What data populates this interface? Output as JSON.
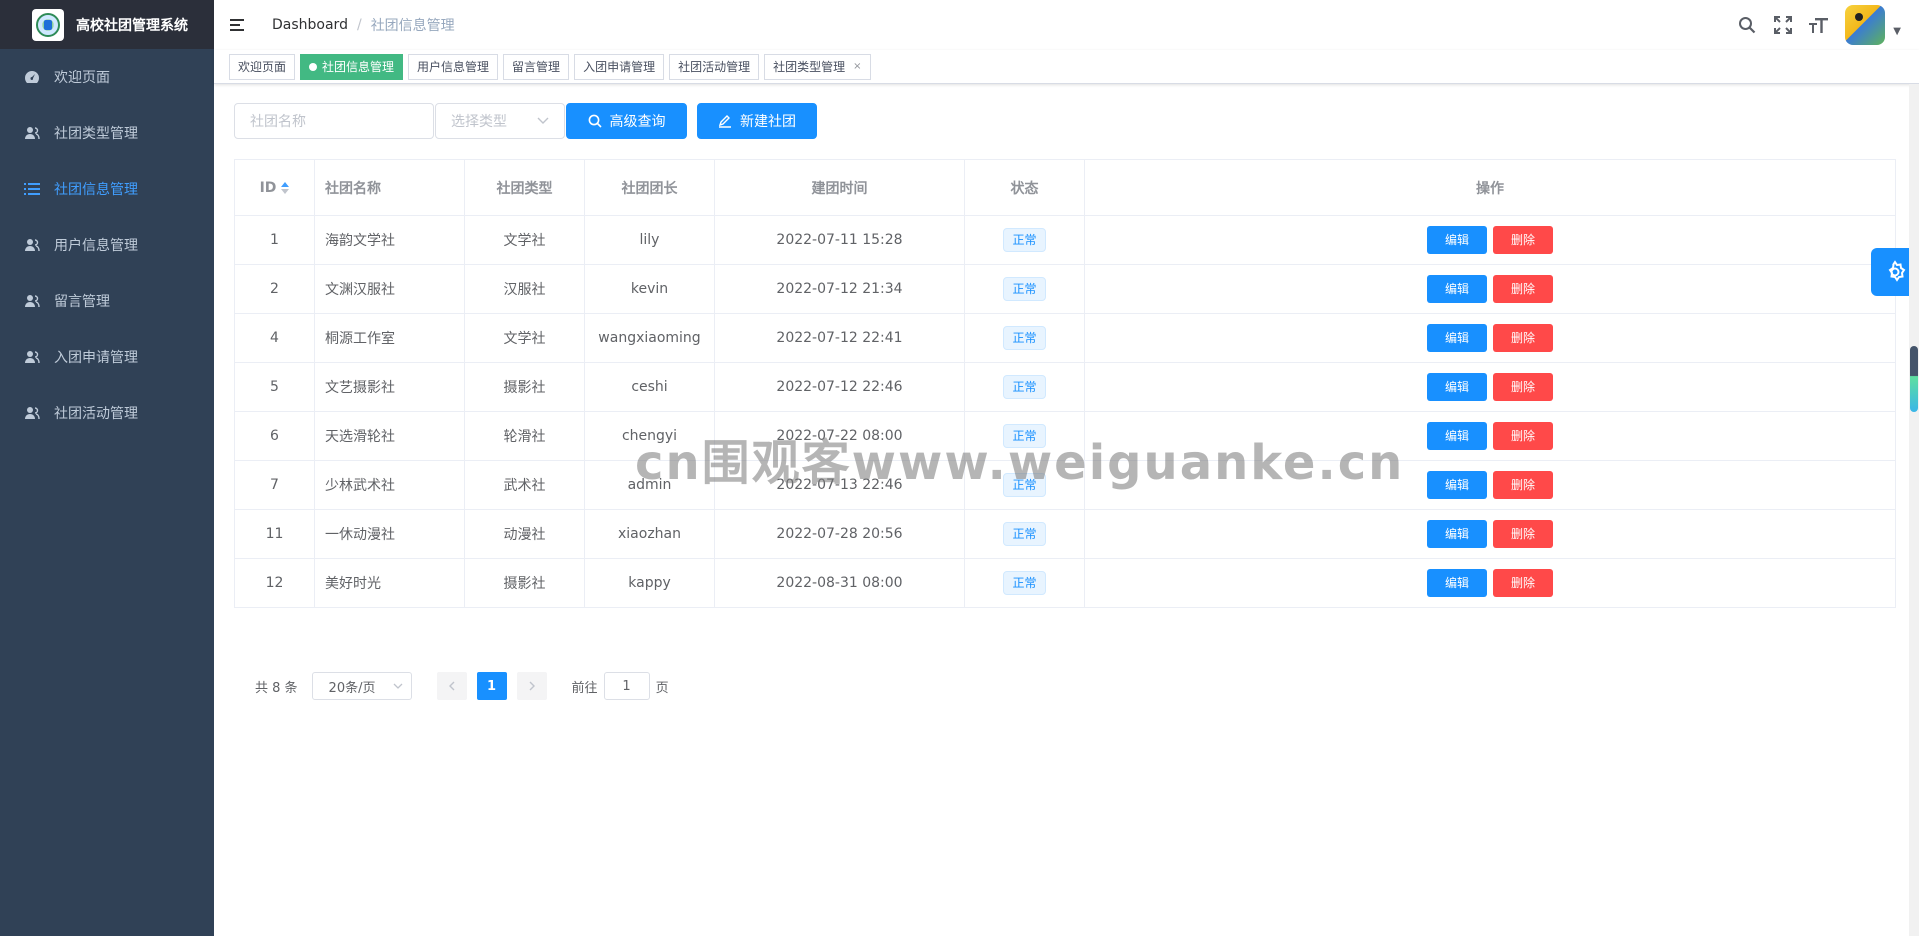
{
  "app": {
    "title": "高校社团管理系统"
  },
  "sidebar": {
    "items": [
      {
        "label": "欢迎页面",
        "icon": "dashboard-icon"
      },
      {
        "label": "社团类型管理",
        "icon": "user-icon"
      },
      {
        "label": "社团信息管理",
        "icon": "list-icon",
        "active": true
      },
      {
        "label": "用户信息管理",
        "icon": "user-icon"
      },
      {
        "label": "留言管理",
        "icon": "user-icon"
      },
      {
        "label": "入团申请管理",
        "icon": "user-icon"
      },
      {
        "label": "社团活动管理",
        "icon": "user-icon"
      }
    ]
  },
  "header": {
    "breadcrumb": {
      "root": "Dashboard",
      "separator": "/",
      "current": "社团信息管理"
    }
  },
  "tags": [
    {
      "label": "欢迎页面"
    },
    {
      "label": "社团信息管理",
      "active": true
    },
    {
      "label": "用户信息管理"
    },
    {
      "label": "留言管理"
    },
    {
      "label": "入团申请管理"
    },
    {
      "label": "社团活动管理"
    },
    {
      "label": "社团类型管理",
      "closable": true,
      "close": "×"
    }
  ],
  "filters": {
    "name_placeholder": "社团名称",
    "type_placeholder": "选择类型",
    "search_label": "高级查询",
    "new_label": "新建社团"
  },
  "table": {
    "columns": [
      "ID",
      "社团名称",
      "社团类型",
      "社团团长",
      "建团时间",
      "状态",
      "操作"
    ],
    "rows": [
      {
        "id": "1",
        "name": "海韵文学社",
        "type": "文学社",
        "leader": "lily",
        "time": "2022-07-11 15:28",
        "status": "正常"
      },
      {
        "id": "2",
        "name": "文渊汉服社",
        "type": "汉服社",
        "leader": "kevin",
        "time": "2022-07-12 21:34",
        "status": "正常"
      },
      {
        "id": "4",
        "name": "桐源工作室",
        "type": "文学社",
        "leader": "wangxiaoming",
        "time": "2022-07-12 22:41",
        "status": "正常"
      },
      {
        "id": "5",
        "name": "文艺摄影社",
        "type": "摄影社",
        "leader": "ceshi",
        "time": "2022-07-12 22:46",
        "status": "正常"
      },
      {
        "id": "6",
        "name": "天选滑轮社",
        "type": "轮滑社",
        "leader": "chengyi",
        "time": "2022-07-22 08:00",
        "status": "正常"
      },
      {
        "id": "7",
        "name": "少林武术社",
        "type": "武术社",
        "leader": "admin",
        "time": "2022-07-13 22:46",
        "status": "正常"
      },
      {
        "id": "11",
        "name": "一休动漫社",
        "type": "动漫社",
        "leader": "xiaozhan",
        "time": "2022-07-28 20:56",
        "status": "正常"
      },
      {
        "id": "12",
        "name": "美好时光",
        "type": "摄影社",
        "leader": "kappy",
        "time": "2022-08-31 08:00",
        "status": "正常"
      }
    ],
    "edit_label": "编辑",
    "delete_label": "删除"
  },
  "pagination": {
    "total": "共 8 条",
    "page_size": "20条/页",
    "current_page": "1",
    "goto_prefix": "前往",
    "goto_value": "1",
    "goto_suffix": "页"
  },
  "watermark": "cn围观客www.weiguanke.cn",
  "colors": {
    "primary": "#1890ff",
    "sidebar": "#304156",
    "active_tag": "#42b983",
    "danger": "#ff4949"
  }
}
